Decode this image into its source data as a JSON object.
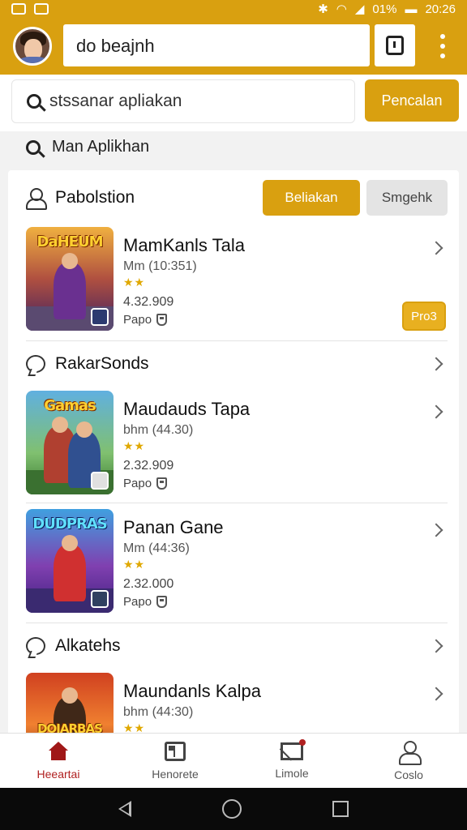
{
  "status_bar": {
    "battery": "01%",
    "time": "20:26"
  },
  "header": {
    "title": "do beajnh"
  },
  "search": {
    "placeholder": "stssanar apliakan",
    "button_label": "Pencalan"
  },
  "section": {
    "label": "Man Aplikhan"
  },
  "recommended": {
    "title": "Pabolstion",
    "btn_primary": "Beliakan",
    "btn_secondary": "Smgehk",
    "app": {
      "name": "MamKanls Tala",
      "meta": "Mm (10:351)",
      "rating": "★★",
      "downloads": "4.32.909",
      "type": "Papo",
      "action": "Pro3"
    }
  },
  "group_sounds": {
    "title": "RakarSonds",
    "apps": [
      {
        "logo": "Gamas",
        "name": "Maudauds Tapa",
        "meta": "bhm (44.30)",
        "rating": "★★",
        "downloads": "2.32.909",
        "type": "Papo"
      },
      {
        "logo": "DUDPRAS",
        "name": "Panan Gane",
        "meta": "Mm (44:36)",
        "rating": "★★",
        "downloads": "2.32.000",
        "type": "Papo"
      }
    ]
  },
  "group_alkatehs": {
    "title": "Alkatehs",
    "app": {
      "logo": "DOJARBAS",
      "name": "Maundanls Kalpa",
      "meta": "bhm (44:30)",
      "rating": "★★"
    }
  },
  "first_logo": "DaHEUM",
  "bottom_nav": [
    {
      "label": "Heeartai",
      "icon": "home-icon"
    },
    {
      "label": "Henorete",
      "icon": "grid-icon"
    },
    {
      "label": "Limole",
      "icon": "mail-icon"
    },
    {
      "label": "Coslo",
      "icon": "person-icon"
    }
  ],
  "colors": {
    "accent": "#d9a010",
    "active_nav": "#b02020"
  }
}
